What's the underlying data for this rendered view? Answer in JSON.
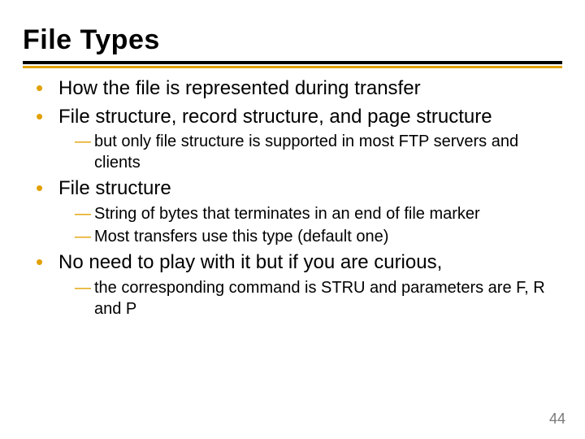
{
  "title": "File Types",
  "bullets": [
    {
      "text": "How the file is represented during transfer",
      "sub": []
    },
    {
      "text": "File structure, record structure, and page structure",
      "sub": [
        "but only file structure is supported in most FTP servers and clients"
      ]
    },
    {
      "text": "File structure",
      "sub": [
        "String of bytes that terminates in an end of file marker",
        "Most transfers use this type (default one)"
      ]
    },
    {
      "text": "No need to play with it but if you are curious,",
      "sub": [
        "the corresponding command is STRU and parameters are F, R and P"
      ]
    }
  ],
  "page_number": "44"
}
